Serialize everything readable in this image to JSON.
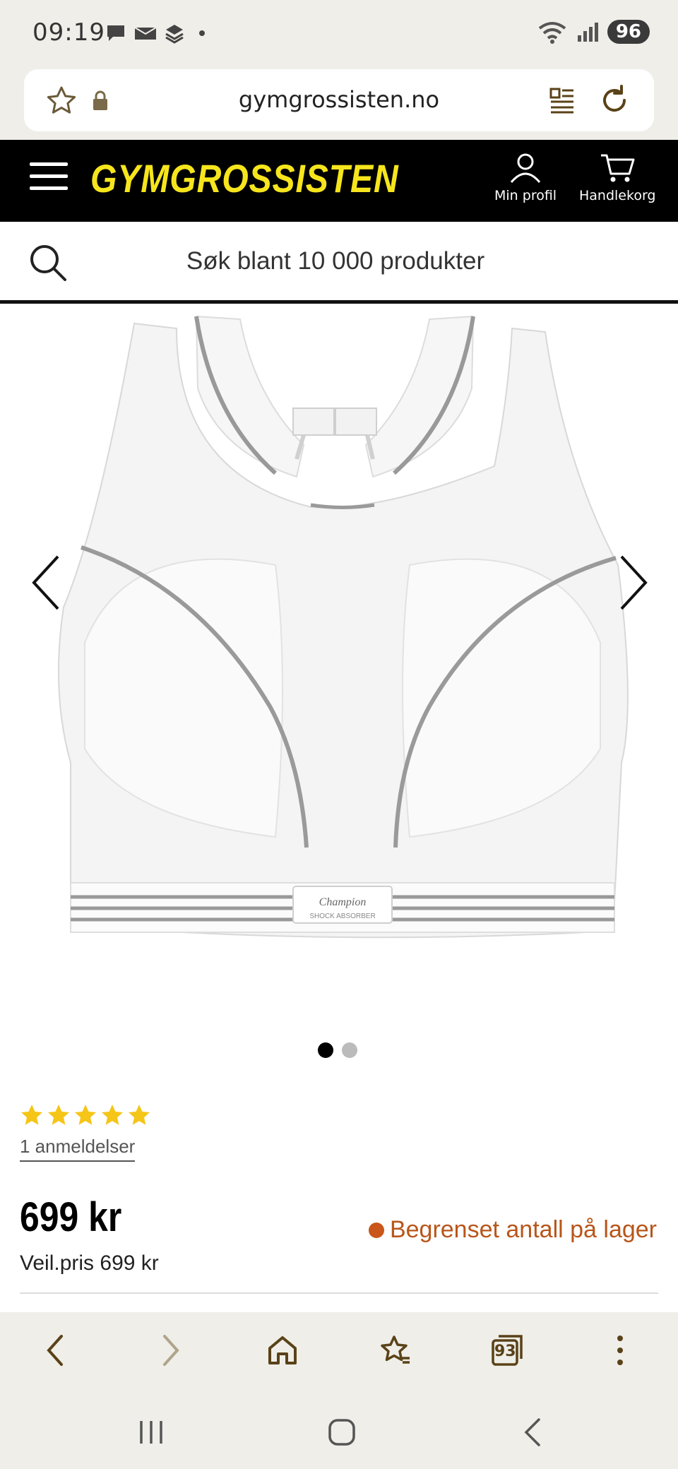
{
  "status": {
    "time": "09:19",
    "battery": "96"
  },
  "browser": {
    "url": "gymgrossisten.no",
    "tab_count": "93"
  },
  "site": {
    "logo": "GYMGROSSISTEN",
    "profile_label": "Min profil",
    "cart_label": "Handlekorg",
    "search_placeholder": "Søk blant 10 000 produkter",
    "accent_color": "#f6e51c"
  },
  "product": {
    "image_count": 2,
    "active_image": 1,
    "rating_stars": 5,
    "reviews_text": "1 anmeldelser",
    "price": "699 kr",
    "rrp": "Veil.pris 699 kr",
    "stock_text": "Begrenset antall på lager",
    "stock_color": "#b8561a",
    "image_brand": "Champion",
    "image_subtext": "SHOCK ABSORBER"
  }
}
